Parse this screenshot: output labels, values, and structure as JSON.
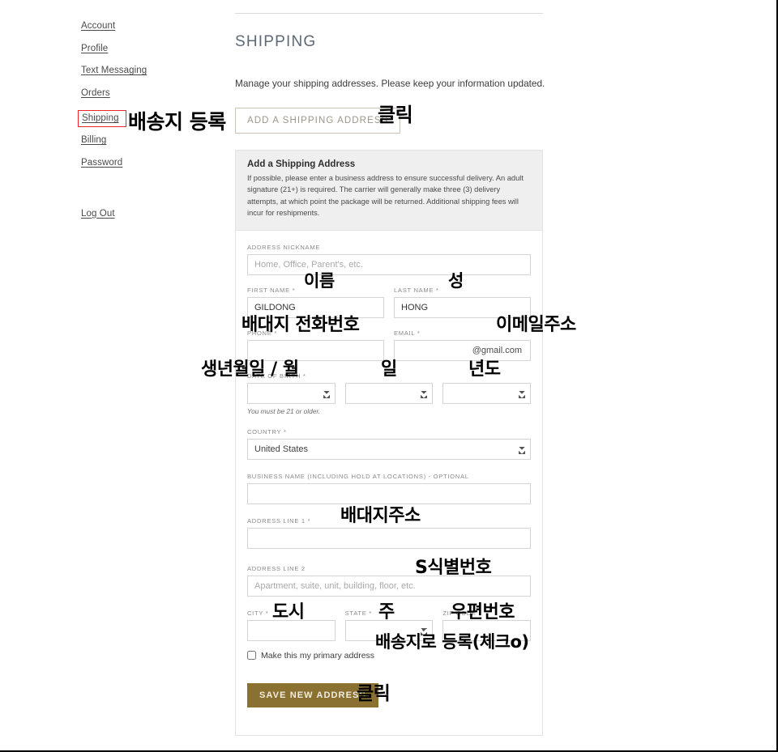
{
  "sidebar": {
    "items": [
      {
        "label": "Account",
        "name": "account"
      },
      {
        "label": "Profile",
        "name": "profile"
      },
      {
        "label": "Text Messaging",
        "name": "text-messaging"
      },
      {
        "label": "Orders",
        "name": "orders"
      },
      {
        "label": "Shipping",
        "name": "shipping"
      },
      {
        "label": "Billing",
        "name": "billing"
      },
      {
        "label": "Password",
        "name": "password"
      }
    ],
    "logout": "Log Out",
    "highlight_color": "#e8262c"
  },
  "main": {
    "title": "SHIPPING",
    "intro": "Manage your shipping addresses. Please keep your information updated.",
    "add_button": "ADD A SHIPPING ADDRESS"
  },
  "panel": {
    "heading": "Add a Shipping Address",
    "description": "If possible, please enter a business address to ensure successful delivery. An adult signature (21+) is required. The carrier will generally make three (3) delivery attempts, at which point the package will be returned. Additional shipping fees will incur for reshipments."
  },
  "form": {
    "nickname_label": "ADDRESS NICKNAME",
    "nickname_placeholder": "Home, Office, Parent's, etc.",
    "nickname_value": "",
    "first_name_label": "FIRST NAME *",
    "first_name_value": "GILDONG",
    "last_name_label": "LAST NAME *",
    "last_name_value": "HONG",
    "phone_label": "PHONE *",
    "phone_value": "",
    "email_label": "EMAIL *",
    "email_value": "@gmail.com",
    "dob_label": "DATE OF BIRTH *",
    "dob_month": "",
    "dob_day": "",
    "dob_year": "",
    "dob_hint": "You must be 21 or older.",
    "country_label": "COUNTRY *",
    "country_value": "United States",
    "business_label": "BUSINESS NAME (INCLUDING HOLD AT LOCATIONS) - OPTIONAL",
    "business_value": "",
    "address1_label": "ADDRESS LINE 1 *",
    "address1_value": "",
    "address2_label": "ADDRESS LINE 2",
    "address2_placeholder": "Apartment, suite, unit, building, floor, etc.",
    "address2_value": "",
    "city_label": "CITY *",
    "city_value": "",
    "state_label": "STATE *",
    "state_value": "",
    "zip_label": "ZIP CODE *",
    "zip_value": "",
    "primary_checkbox_label": "Make this my primary address",
    "primary_checked": false,
    "save_button": "SAVE NEW ADDRESS",
    "save_button_color": "#8a7132"
  },
  "annotations": {
    "shipping_nav": "배송지 등록",
    "add_button": "클릭",
    "first_name": "이름",
    "last_name": "성",
    "phone": "배대지 전화번호",
    "email": "이메일주소",
    "dob": "생년월일 / 월",
    "dob_day": "일",
    "dob_year": "년도",
    "address1": "배대지주소",
    "address2": "S식별번호",
    "city": "도시",
    "state": "주",
    "zip": "우편번호",
    "primary": "배송지로 등록(체크o)",
    "save": "클릭"
  }
}
